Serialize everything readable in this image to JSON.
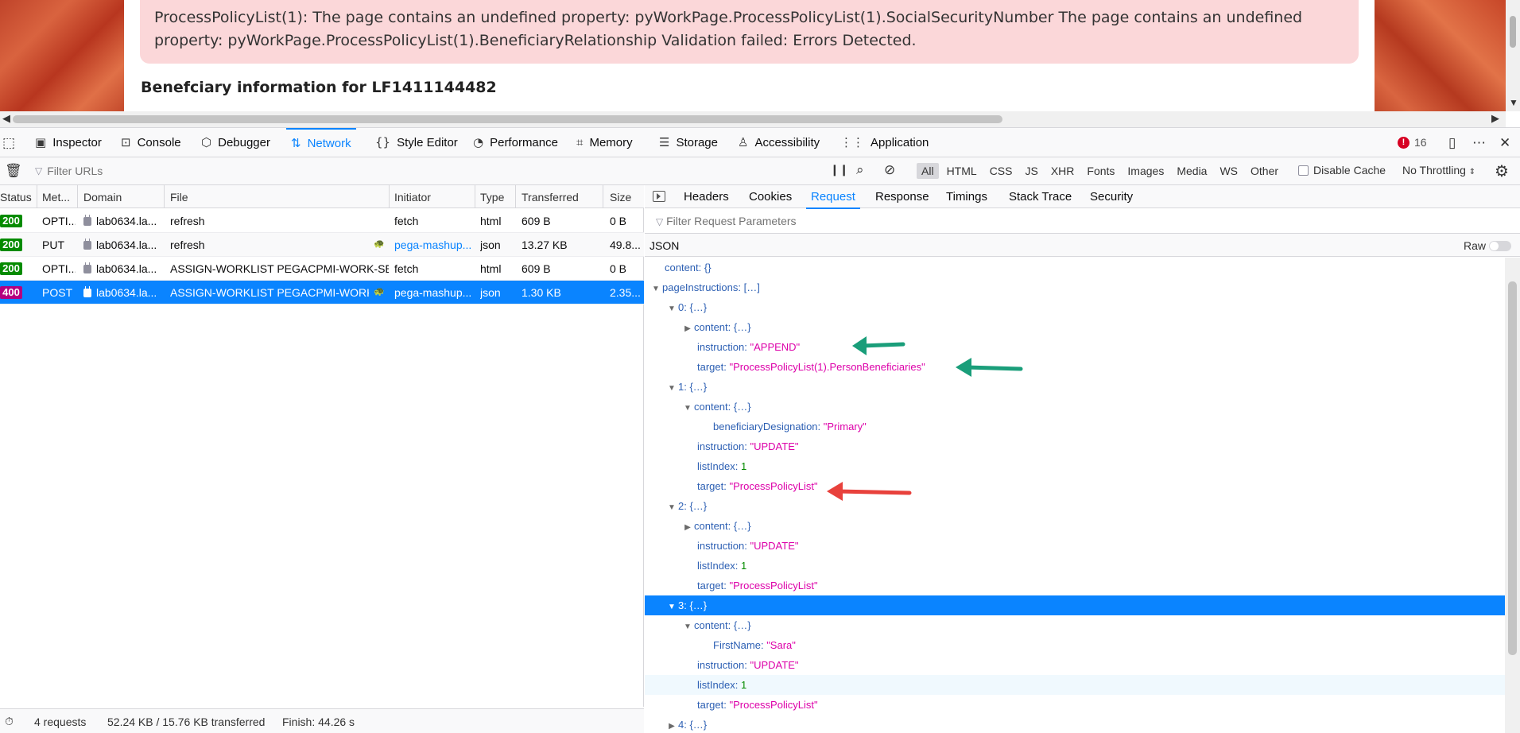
{
  "page": {
    "error_message": "ProcessPolicyList(1): The page contains an undefined property: pyWorkPage.ProcessPolicyList(1).SocialSecurityNumber The page contains an undefined property: pyWorkPage.ProcessPolicyList(1).BeneficiaryRelationship Validation failed: Errors Detected.",
    "heading": "Benefciary information for LF1411144482"
  },
  "devtools": {
    "tabs": [
      {
        "label": "Inspector",
        "icon": "inspector-icon"
      },
      {
        "label": "Console",
        "icon": "console-icon"
      },
      {
        "label": "Debugger",
        "icon": "debugger-icon"
      },
      {
        "label": "Network",
        "icon": "network-icon"
      },
      {
        "label": "Style Editor",
        "icon": "style-editor-icon"
      },
      {
        "label": "Performance",
        "icon": "performance-icon"
      },
      {
        "label": "Memory",
        "icon": "memory-icon"
      },
      {
        "label": "Storage",
        "icon": "storage-icon"
      },
      {
        "label": "Accessibility",
        "icon": "accessibility-icon"
      },
      {
        "label": "Application",
        "icon": "application-icon"
      }
    ],
    "selected_tab": "Network",
    "error_count": "16",
    "accent_color": "#0a84ff"
  },
  "network": {
    "filter_placeholder": "Filter URLs",
    "type_filters": [
      "All",
      "HTML",
      "CSS",
      "JS",
      "XHR",
      "Fonts",
      "Images",
      "Media",
      "WS",
      "Other"
    ],
    "selected_type": "All",
    "disable_cache_label": "Disable Cache",
    "throttling_label": "No Throttling",
    "columns": [
      "Status",
      "Met...",
      "Domain",
      "File",
      "Initiator",
      "Type",
      "Transferred",
      "Size"
    ],
    "requests": [
      {
        "status": "200",
        "status_color": "#058b00",
        "method": "OPTI...",
        "domain": "lab0634.la...",
        "file": "refresh",
        "initiator": "fetch",
        "type": "html",
        "transferred": "609 B",
        "size": "0 B"
      },
      {
        "status": "200",
        "status_color": "#058b00",
        "method": "PUT",
        "domain": "lab0634.la...",
        "file": "refresh",
        "initiator": "pega-mashup...",
        "type": "json",
        "transferred": "13.27 KB",
        "size": "49.8..."
      },
      {
        "status": "200",
        "status_color": "#058b00",
        "method": "OPTI...",
        "domain": "lab0634.la...",
        "file": "ASSIGN-WORKLIST PEGACPMI-WORK-SERVI",
        "initiator": "fetch",
        "type": "html",
        "transferred": "609 B",
        "size": "0 B"
      },
      {
        "status": "400",
        "status_color": "#b5007f",
        "method": "POST",
        "domain": "lab0634.la...",
        "file": "ASSIGN-WORKLIST PEGACPMI-WORK-S",
        "initiator": "pega-mashup...",
        "type": "json",
        "transferred": "1.30 KB",
        "size": "2.35..."
      }
    ],
    "summary": {
      "requests": "4 requests",
      "transferred": "52.24 KB / 15.76 KB transferred",
      "finish": "Finish: 44.26 s"
    }
  },
  "details": {
    "tabs": [
      "Headers",
      "Cookies",
      "Request",
      "Response",
      "Timings",
      "Stack Trace",
      "Security"
    ],
    "selected_tab": "Request",
    "filter_placeholder": "Filter Request Parameters",
    "section_label": "JSON",
    "raw_label": "Raw",
    "tree": [
      {
        "key": "content",
        "brace": "{}"
      },
      {
        "key": "pageInstructions",
        "brace": "[…]"
      },
      {
        "key": "0",
        "brace": "{…}"
      },
      {
        "key": "content",
        "brace": "{…}"
      },
      {
        "key": "instruction",
        "value": "\"APPEND\""
      },
      {
        "key": "target",
        "value": "\"ProcessPolicyList(1).PersonBeneficiaries\""
      },
      {
        "key": "1",
        "brace": "{…}"
      },
      {
        "key": "content",
        "brace": "{…}"
      },
      {
        "key": "beneficiaryDesignation",
        "value": "\"Primary\""
      },
      {
        "key": "instruction",
        "value": "\"UPDATE\""
      },
      {
        "key": "listIndex",
        "value": "1"
      },
      {
        "key": "target",
        "value": "\"ProcessPolicyList\""
      },
      {
        "key": "2",
        "brace": "{…}"
      },
      {
        "key": "content",
        "brace": "{…}"
      },
      {
        "key": "instruction",
        "value": "\"UPDATE\""
      },
      {
        "key": "listIndex",
        "value": "1"
      },
      {
        "key": "target",
        "value": "\"ProcessPolicyList\""
      },
      {
        "key": "3",
        "brace": "{…}"
      },
      {
        "key": "content",
        "brace": "{…}"
      },
      {
        "key": "FirstName",
        "value": "\"Sara\""
      },
      {
        "key": "instruction",
        "value": "\"UPDATE\""
      },
      {
        "key": "listIndex",
        "value": "1"
      },
      {
        "key": "target",
        "value": "\"ProcessPolicyList\""
      },
      {
        "key": "4",
        "brace": "{…}"
      }
    ],
    "annotation_colors": {
      "green": "#1a9e7a",
      "red": "#e8413c"
    }
  }
}
